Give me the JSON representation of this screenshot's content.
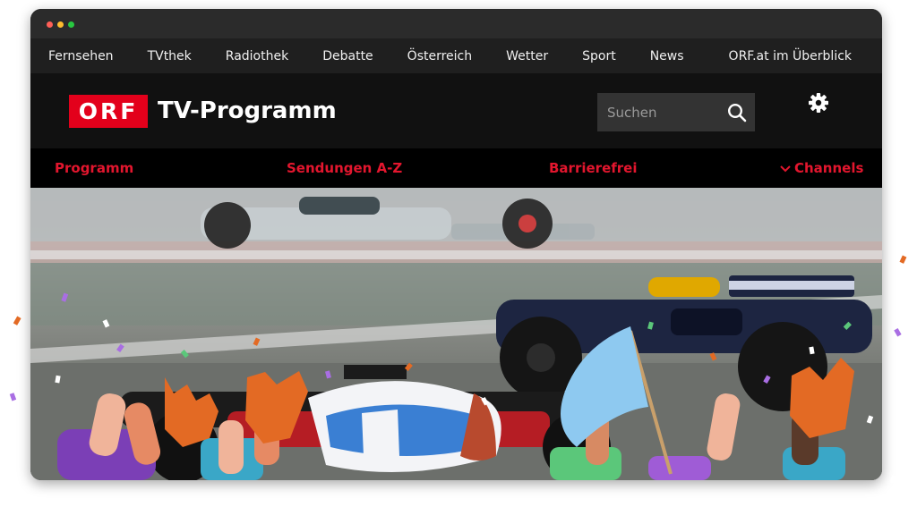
{
  "top_nav": {
    "items": [
      {
        "label": "Fernsehen"
      },
      {
        "label": "TVthek"
      },
      {
        "label": "Radiothek"
      },
      {
        "label": "Debatte"
      },
      {
        "label": "Österreich"
      },
      {
        "label": "Wetter"
      },
      {
        "label": "Sport"
      },
      {
        "label": "News"
      },
      {
        "label": "ORF.at im Überblick"
      }
    ]
  },
  "header": {
    "logo_text": "ORF",
    "site_title": "TV-Programm",
    "search": {
      "placeholder": "Suchen",
      "value": ""
    },
    "settings_icon": "gear-icon"
  },
  "sub_nav": {
    "items": [
      {
        "label": "Programm"
      },
      {
        "label": "Sendungen A-Z"
      },
      {
        "label": "Barrierefrei"
      },
      {
        "label": "Channels",
        "icon": "chevron-down-icon"
      }
    ]
  },
  "colors": {
    "brand_red": "#e3001b",
    "nav_red": "#e3162e",
    "top_nav_bg": "#1f1f1f",
    "header_bg": "#111111",
    "sub_nav_bg": "#000000",
    "search_bg": "#333333"
  }
}
